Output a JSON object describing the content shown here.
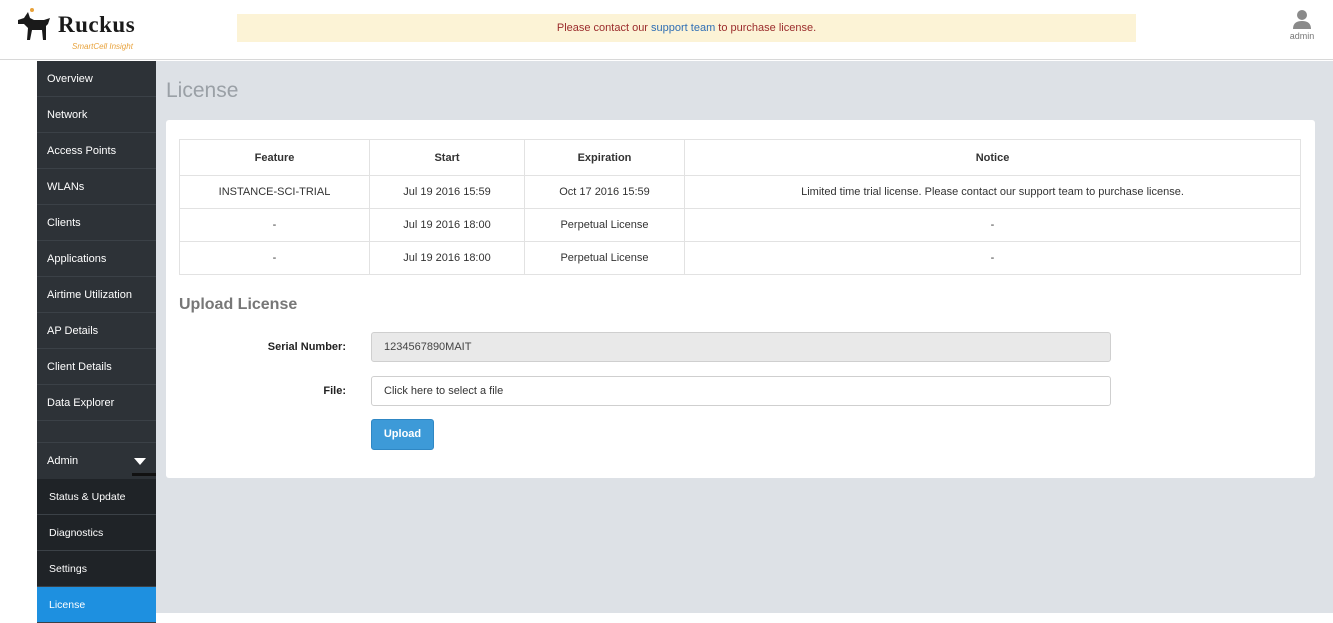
{
  "brand": {
    "name": "Ruckus",
    "tagline": "SmartCell Insight"
  },
  "banner": {
    "prefix": "Please contact our ",
    "link": "support team",
    "suffix": " to purchase license."
  },
  "user": {
    "name": "admin"
  },
  "sidebar": {
    "items": [
      {
        "label": "Overview"
      },
      {
        "label": "Network"
      },
      {
        "label": "Access Points"
      },
      {
        "label": "WLANs"
      },
      {
        "label": "Clients"
      },
      {
        "label": "Applications"
      },
      {
        "label": "Airtime Utilization"
      },
      {
        "label": "AP Details"
      },
      {
        "label": "Client Details"
      },
      {
        "label": "Data Explorer"
      }
    ],
    "admin_label": "Admin",
    "sub_items": [
      {
        "label": "Status & Update"
      },
      {
        "label": "Diagnostics"
      },
      {
        "label": "Settings"
      },
      {
        "label": "License"
      }
    ]
  },
  "page": {
    "title": "License"
  },
  "license_table": {
    "headers": [
      "Feature",
      "Start",
      "Expiration",
      "Notice"
    ],
    "rows": [
      [
        "INSTANCE-SCI-TRIAL",
        "Jul 19 2016 15:59",
        "Oct 17 2016 15:59",
        "Limited time trial license. Please contact our support team to purchase license."
      ],
      [
        "-",
        "Jul 19 2016 18:00",
        "Perpetual License",
        "-"
      ],
      [
        "-",
        "Jul 19 2016 18:00",
        "Perpetual License",
        "-"
      ]
    ]
  },
  "upload": {
    "title": "Upload License",
    "serial_label": "Serial Number:",
    "serial_value": "1234567890MAIT",
    "file_label": "File:",
    "file_placeholder": "Click here to select a file",
    "button_label": "Upload"
  },
  "colors": {
    "sidebar_bg": "#2d3237",
    "active_bg": "#1e90e0",
    "button_bg": "#3d9ad8",
    "banner_bg": "#fcf3d6",
    "main_bg": "#dde1e6"
  }
}
